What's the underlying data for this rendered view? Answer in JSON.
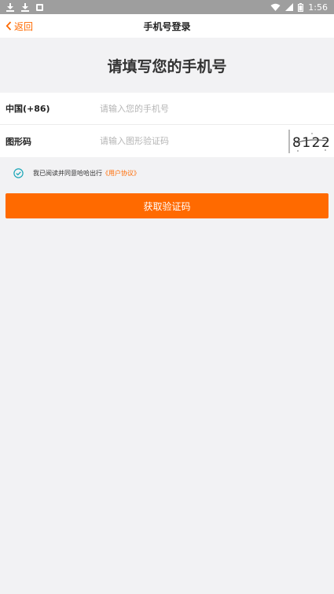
{
  "status_bar": {
    "time": "1:56"
  },
  "nav": {
    "back_label": "返回",
    "title": "手机号登录"
  },
  "heading": "请填写您的手机号",
  "phone_row": {
    "label": "中国(+86)",
    "placeholder": "请输入您的手机号",
    "value": ""
  },
  "captcha_row": {
    "label": "图形码",
    "placeholder": "请输入图形验证码",
    "value": "",
    "captcha_text": "8122"
  },
  "agreement": {
    "text": "我已阅读并同意哈哈出行",
    "link": "《用户协议》",
    "checked": true
  },
  "submit_label": "获取验证码",
  "colors": {
    "accent": "#ff6a00",
    "check": "#1aa6b7",
    "status_bar": "#9e9e9e"
  }
}
